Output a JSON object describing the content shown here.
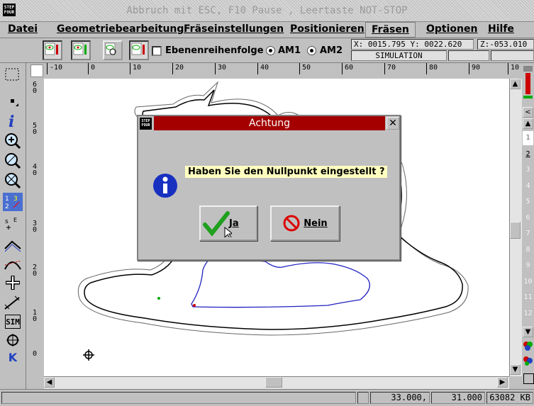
{
  "window": {
    "title": "Abbruch mit ESC,  F10 Pause , Leertaste NOT-STOP",
    "logo_text": "STEP FOUR"
  },
  "menu": {
    "items": [
      {
        "label": "Datei"
      },
      {
        "label": "Geometriebearbeitung"
      },
      {
        "label": "Fräseinstellungen"
      },
      {
        "label": "Positionieren"
      },
      {
        "label": "Fräsen"
      },
      {
        "label": "Optionen"
      },
      {
        "label": "Hilfe"
      }
    ]
  },
  "toolbar": {
    "ebenen_label": "Ebenenreihenfolge",
    "am1_label": "AM1",
    "am2_label": "AM2",
    "coords": "X: 0015.795 Y: 0022.620",
    "z_coord": "Z:-053.010",
    "mode": "SIMULATION"
  },
  "ruler": {
    "h_ticks": [
      "-10",
      "0",
      "10",
      "20",
      "30",
      "40",
      "50",
      "60",
      "70",
      "80",
      "90",
      "10"
    ],
    "v_ticks": [
      "6\n0",
      "5\n0",
      "4\n0",
      "3\n0",
      "2\n0",
      "1\n0",
      "0"
    ]
  },
  "left_tools": {
    "k_label": "K",
    "sim_label": "SIM"
  },
  "right_panel": {
    "numbers": [
      "1",
      "2",
      "3",
      "4",
      "5",
      "6",
      "7",
      "8",
      "9",
      "10",
      "11",
      "12"
    ]
  },
  "dialog": {
    "title": "Achtung",
    "message": "Haben Sie den Nullpunkt eingestellt ?",
    "yes_label": "Ja",
    "no_label": "Nein",
    "close_label": "✕"
  },
  "status": {
    "x": "33.000,",
    "y": "31.000",
    "memory": "63082 KB"
  },
  "colors": {
    "dialog_title": "#a40000",
    "message_bg": "#ffffc0",
    "toolpath": "#2020c0"
  }
}
